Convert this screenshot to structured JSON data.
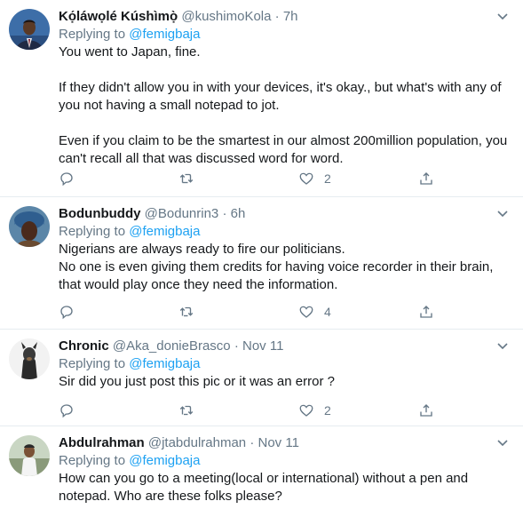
{
  "colors": {
    "accent": "#1da1f2",
    "muted": "#657786",
    "divider": "#e6ecf0",
    "text": "#14171a"
  },
  "replying_prefix": "Replying to",
  "tweets": [
    {
      "name": "Kọ́láwọlé Kúshìmọ̀",
      "handle": "@kushimoKola",
      "dot": "·",
      "time": "7h",
      "mention": "@femigbaja",
      "text": "You went to Japan, fine.\n\nIf they didn't allow you in with your devices, it's okay., but what's with any of\nyou not having a small notepad to jot.\n\nEven if you claim to be the smartest in our almost 200million population, you\ncan't recall all that was discussed word for word.",
      "likes": "2",
      "avatar": "man-in-suit"
    },
    {
      "name": "Bodunbuddy",
      "handle": "@Bodunrin3",
      "dot": "·",
      "time": "6h",
      "mention": "@femigbaja",
      "text": "Nigerians are always ready to fire our politicians.\nNo one is even giving them credits for having voice recorder in their brain,\nthat would play once they need the information.",
      "likes": "4",
      "avatar": "woman-headwrap"
    },
    {
      "name": "Chronic",
      "handle": "@Aka_donieBrasco",
      "dot": "·",
      "time": "Nov 11",
      "mention": "@femigbaja",
      "text": "Sir did you just post this pic or it was an error ?",
      "likes": "2",
      "avatar": "dog"
    },
    {
      "name": "Abdulrahman",
      "handle": "@jtabdulrahman",
      "dot": "·",
      "time": "Nov 11",
      "mention": "@femigbaja",
      "text": "How can you go to a meeting(local or international) without a pen and\nnotepad. Who are these folks please?",
      "likes": "",
      "avatar": "man-outdoors"
    }
  ]
}
